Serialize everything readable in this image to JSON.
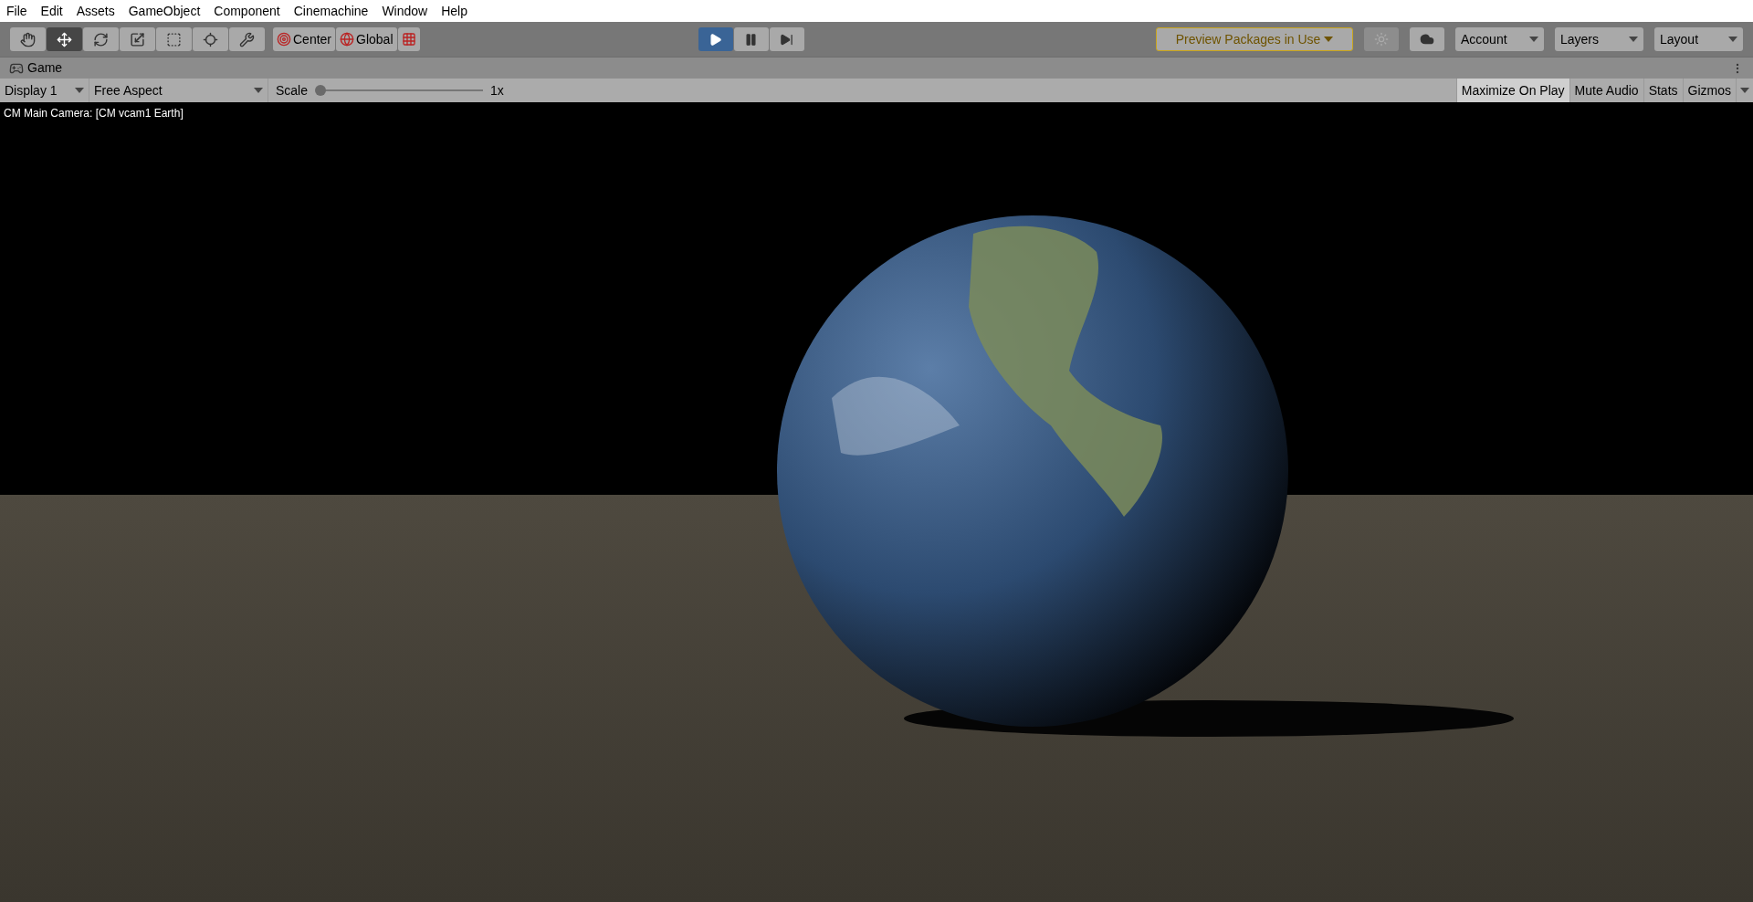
{
  "menu": [
    "File",
    "Edit",
    "Assets",
    "GameObject",
    "Component",
    "Cinemachine",
    "Window",
    "Help"
  ],
  "tools": [
    {
      "kind": "hand",
      "selected": false
    },
    {
      "kind": "move",
      "selected": true
    },
    {
      "kind": "rotate",
      "selected": false
    },
    {
      "kind": "scale",
      "selected": false
    },
    {
      "kind": "rect",
      "selected": false
    },
    {
      "kind": "transform",
      "selected": false
    },
    {
      "kind": "custom",
      "selected": false
    }
  ],
  "pivot_buttons": [
    {
      "kind": "center",
      "label": "Center"
    },
    {
      "kind": "global",
      "label": "Global"
    },
    {
      "kind": "snap"
    }
  ],
  "play_controls": [
    {
      "kind": "play",
      "selected": true
    },
    {
      "kind": "pause",
      "selected": false
    },
    {
      "kind": "step",
      "selected": false
    }
  ],
  "preview_packages": "Preview Packages in Use",
  "right_buttons": [
    {
      "kind": "sun",
      "disabled": true
    },
    {
      "kind": "cloud",
      "disabled": false
    }
  ],
  "dropdowns": [
    "Account",
    "Layers",
    "Layout"
  ],
  "tab": {
    "label": "Game"
  },
  "game_toolbar": {
    "display": "Display 1",
    "aspect": "Free Aspect",
    "scale_label": "Scale",
    "scale": {
      "level": 0
    },
    "scale_value": "1x",
    "toggles": [
      {
        "label": "Maximize On Play",
        "on": true
      },
      {
        "label": "Mute Audio",
        "on": false
      },
      {
        "label": "Stats",
        "on": false
      },
      {
        "label": "Gizmos",
        "on": false
      }
    ]
  },
  "camera_label": "CM Main Camera: [CM vcam1 Earth]"
}
